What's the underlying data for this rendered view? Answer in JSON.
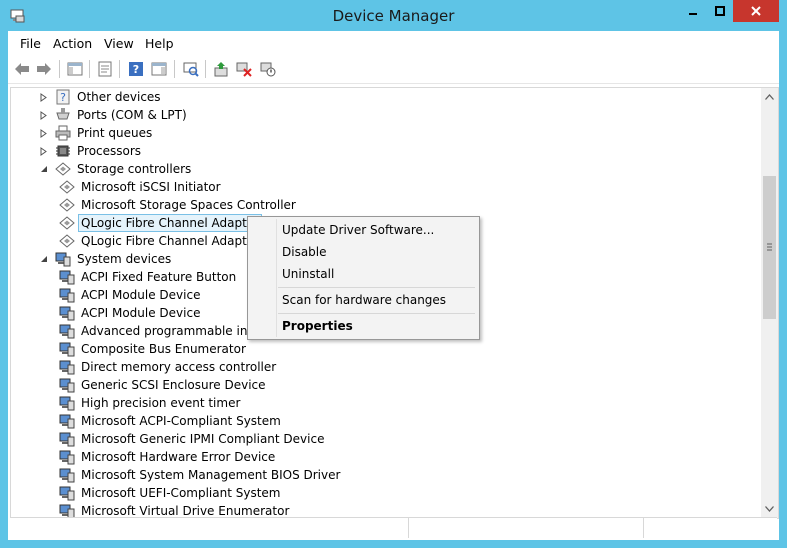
{
  "window": {
    "title": "Device Manager"
  },
  "menu": [
    "File",
    "Action",
    "View",
    "Help"
  ],
  "tree": [
    {
      "label": "Other devices",
      "expander": "collapsed",
      "icon": "unknown-device-icon"
    },
    {
      "label": "Ports (COM & LPT)",
      "expander": "collapsed",
      "icon": "port-icon"
    },
    {
      "label": "Print queues",
      "expander": "collapsed",
      "icon": "printer-icon"
    },
    {
      "label": "Processors",
      "expander": "collapsed",
      "icon": "processor-icon"
    },
    {
      "label": "Storage controllers",
      "expander": "expanded",
      "icon": "storage-controller-icon"
    },
    {
      "label": "Microsoft iSCSI Initiator",
      "icon": "storage-controller-icon"
    },
    {
      "label": "Microsoft Storage Spaces Controller",
      "icon": "storage-controller-icon"
    },
    {
      "label": "QLogic Fibre Channel Adapter",
      "icon": "storage-controller-icon",
      "selected": true
    },
    {
      "label": "QLogic Fibre Channel Adapter",
      "icon": "storage-controller-icon"
    },
    {
      "label": "System devices",
      "expander": "expanded",
      "icon": "system-device-icon"
    },
    {
      "label": "ACPI Fixed Feature Button",
      "icon": "system-device-icon"
    },
    {
      "label": "ACPI Module Device",
      "icon": "system-device-icon"
    },
    {
      "label": "ACPI Module Device",
      "icon": "system-device-icon"
    },
    {
      "label": "Advanced programmable interrupt controller",
      "icon": "system-device-icon"
    },
    {
      "label": "Composite Bus Enumerator",
      "icon": "system-device-icon"
    },
    {
      "label": "Direct memory access controller",
      "icon": "system-device-icon"
    },
    {
      "label": "Generic SCSI Enclosure Device",
      "icon": "system-device-icon"
    },
    {
      "label": "High precision event timer",
      "icon": "system-device-icon"
    },
    {
      "label": "Microsoft ACPI-Compliant System",
      "icon": "system-device-icon"
    },
    {
      "label": "Microsoft Generic IPMI Compliant Device",
      "icon": "system-device-icon"
    },
    {
      "label": "Microsoft Hardware Error Device",
      "icon": "system-device-icon"
    },
    {
      "label": "Microsoft System Management BIOS Driver",
      "icon": "system-device-icon"
    },
    {
      "label": "Microsoft UEFI-Compliant System",
      "icon": "system-device-icon"
    },
    {
      "label": "Microsoft Virtual Drive Enumerator",
      "icon": "system-device-icon"
    }
  ],
  "context_menu": {
    "update": "Update Driver Software...",
    "disable": "Disable",
    "uninstall": "Uninstall",
    "scan": "Scan for hardware changes",
    "properties": "Properties"
  },
  "colors": {
    "titlebar": "#5ec4e6",
    "close": "#c7362d",
    "selection": "#e5f3fb"
  }
}
